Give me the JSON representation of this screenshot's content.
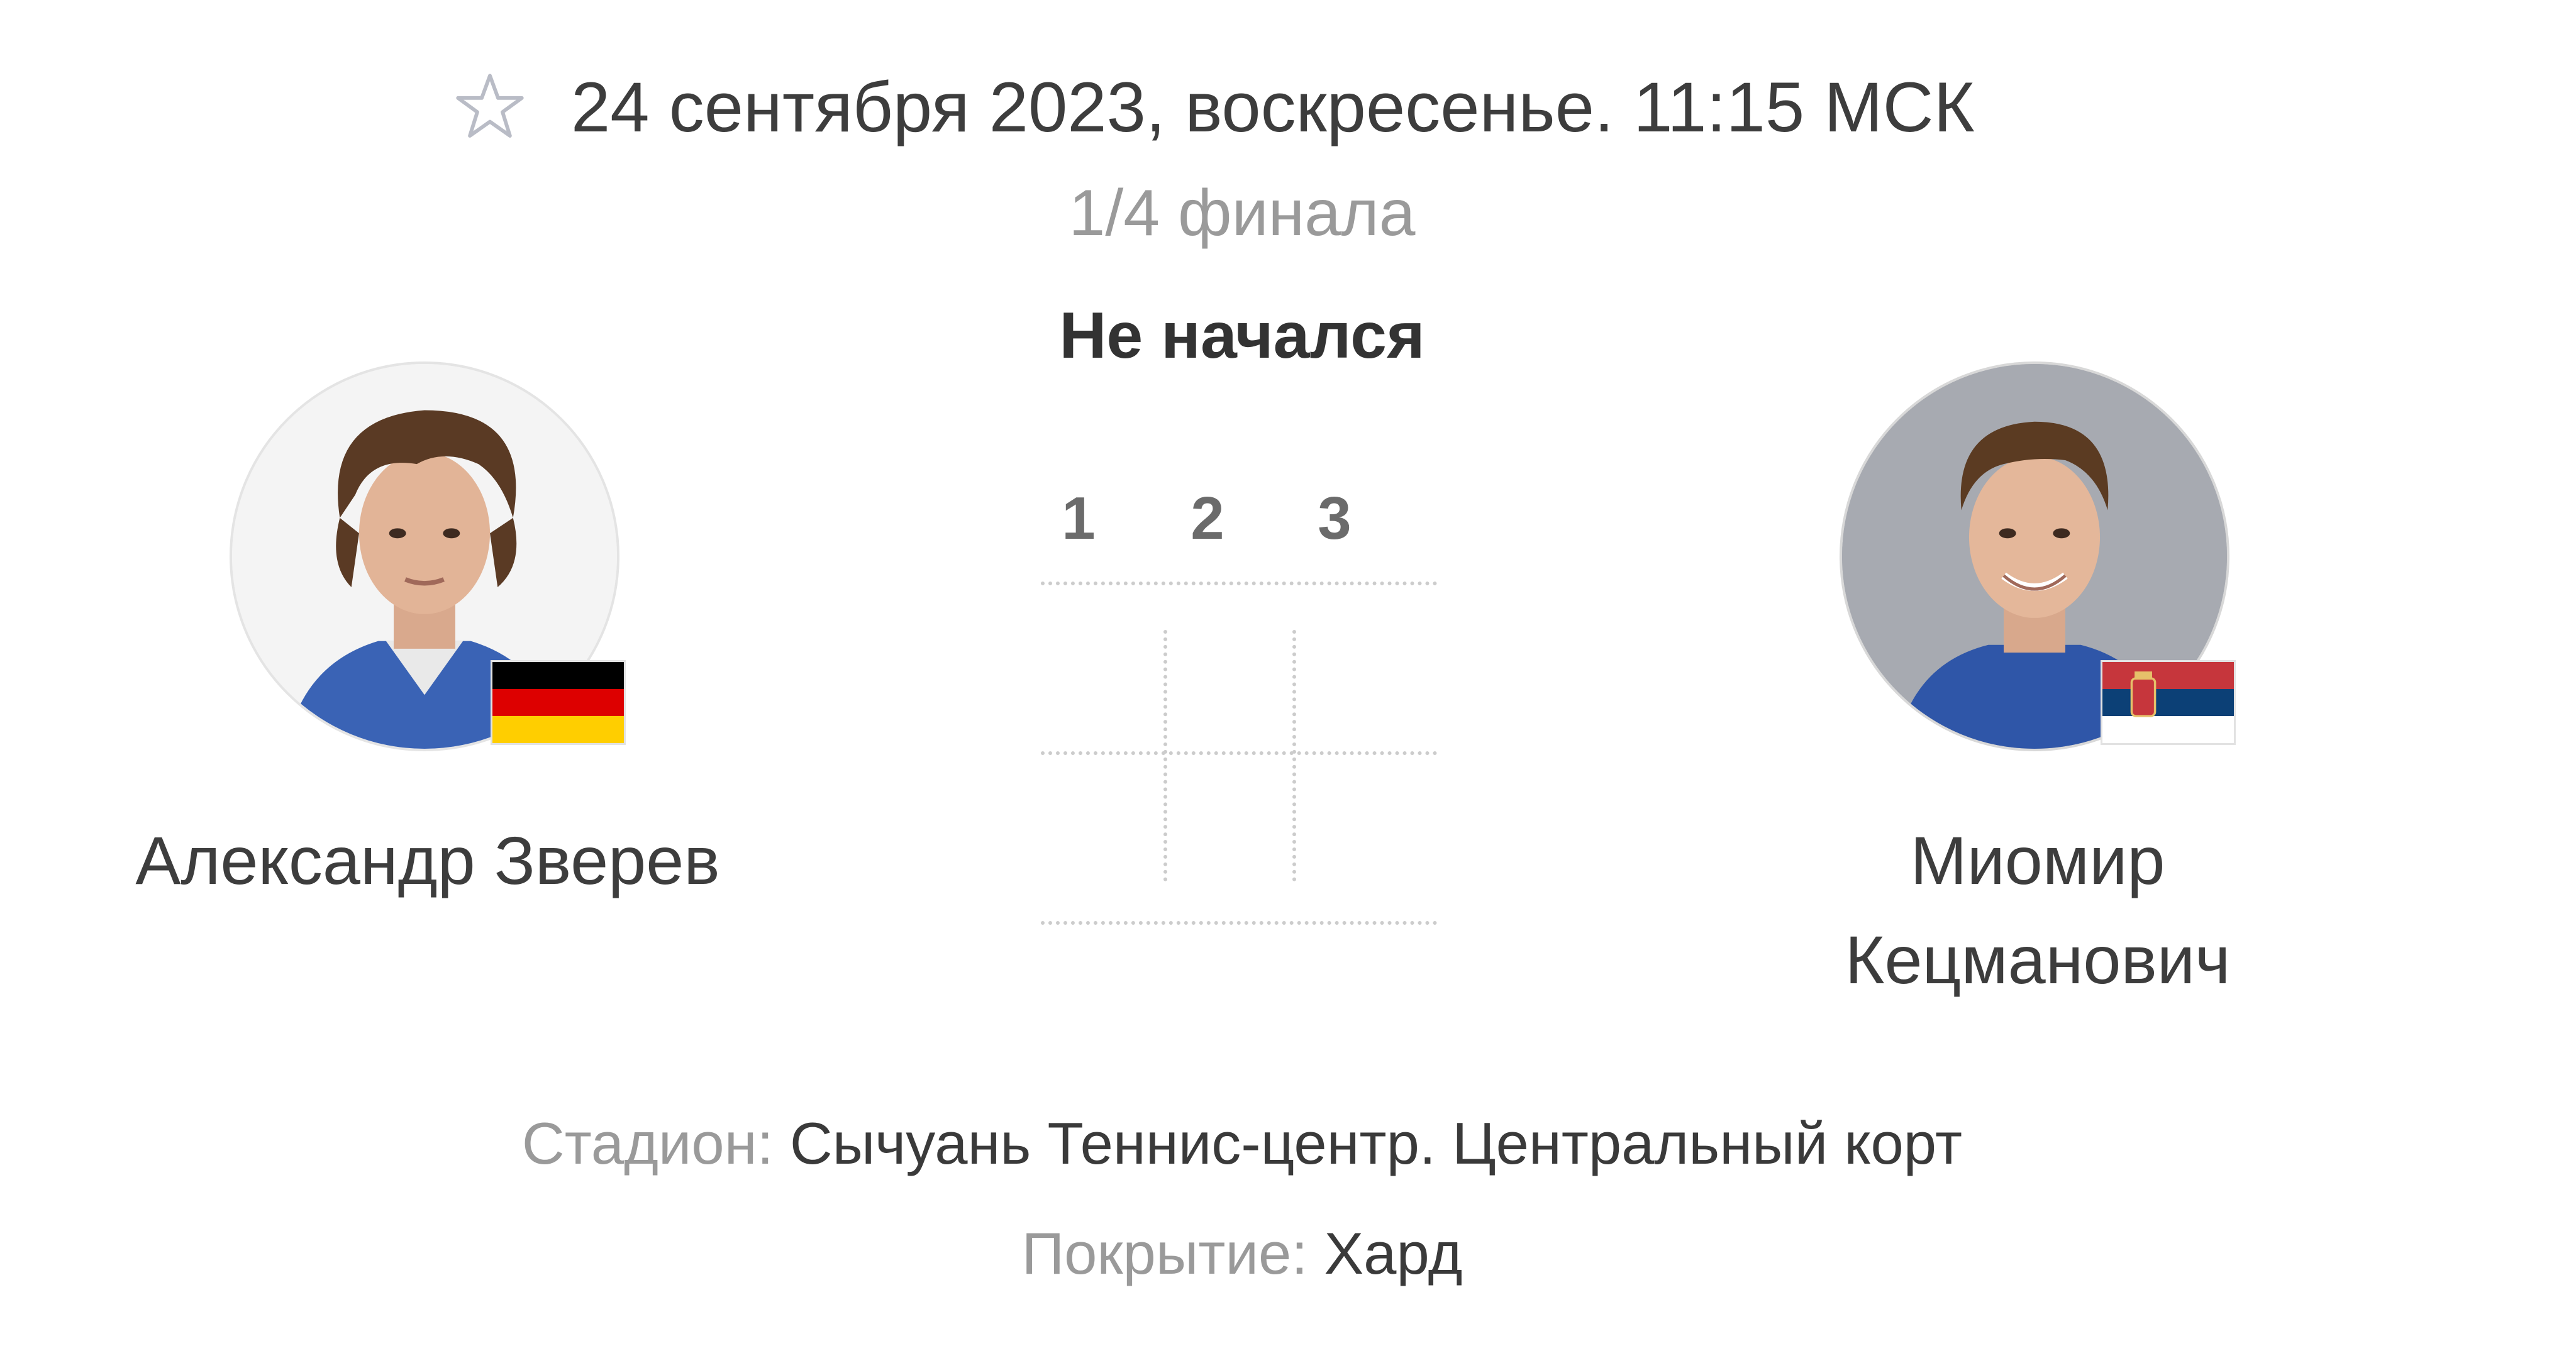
{
  "match": {
    "date_line": "24 сентября 2023, воскресенье. 11:15 МСК",
    "round": "1/4 финала",
    "status": "Не начался"
  },
  "players": {
    "left": {
      "name": "Александр Зверев",
      "flag": "germany-flag-icon",
      "flag_colors": [
        "#000000",
        "#dd0000",
        "#ffce00"
      ]
    },
    "right": {
      "name_line1": "Миомир",
      "name_line2": "Кецманович",
      "flag": "serbia-flag-icon",
      "flag_colors": [
        "#c6363c",
        "#0c4076",
        "#ffffff"
      ]
    }
  },
  "score": {
    "sets": [
      "1",
      "2",
      "3"
    ]
  },
  "venue": {
    "stadium_label": "Стадион:",
    "stadium_value": "Сычуань Теннис-центр. Центральный корт",
    "surface_label": "Покрытие:",
    "surface_value": "Хард"
  },
  "icons": {
    "favorite": "star-outline-icon"
  },
  "colors": {
    "muted_text": "#9a9a9a",
    "main_text": "#3d3d3d",
    "grid_dots": "#cccccc"
  }
}
